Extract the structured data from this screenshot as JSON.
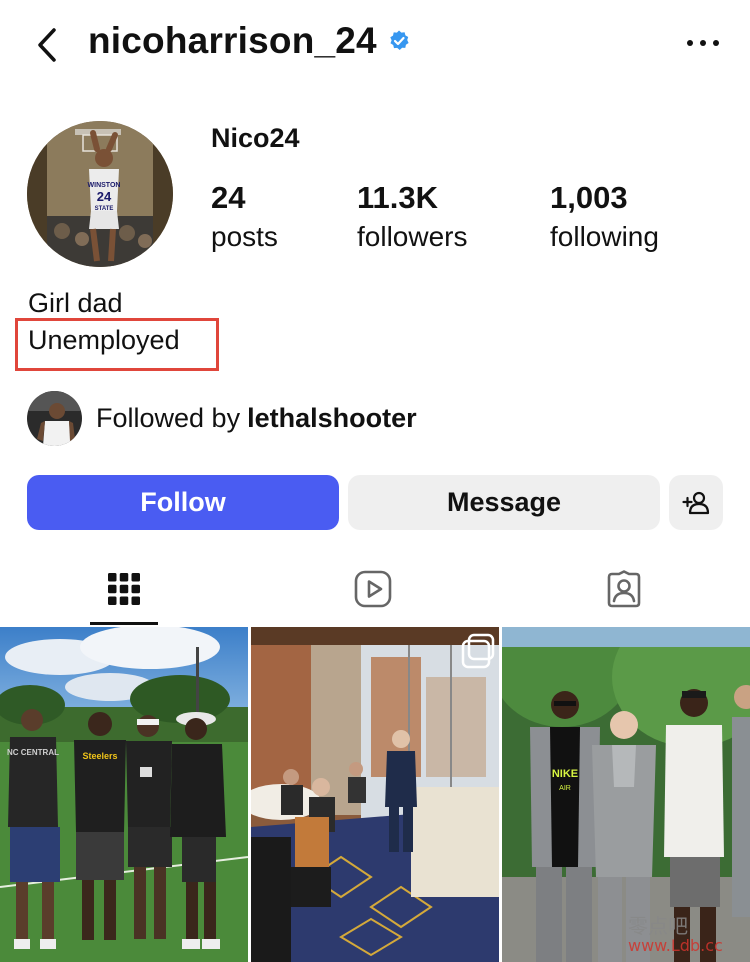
{
  "header": {
    "username": "nicoharrison_24",
    "verified": true,
    "back_icon": "chevron-left-icon",
    "more_icon": "more-horizontal-icon"
  },
  "profile": {
    "display_name": "Nico24",
    "stats": [
      {
        "value": "24",
        "label": "posts"
      },
      {
        "value": "11.3K",
        "label": "followers"
      },
      {
        "value": "1,003",
        "label": "following"
      }
    ],
    "bio": [
      "Girl dad",
      "Unemployed"
    ],
    "highlight_color": "#e0463b"
  },
  "followed_by": {
    "prefix": "Followed by",
    "name": "lethalshooter"
  },
  "actions": {
    "follow_label": "Follow",
    "message_label": "Message",
    "add_user_icon": "add-user-icon",
    "accent_color": "#4a5cf2"
  },
  "tabs": [
    {
      "name": "grid",
      "icon": "grid-icon",
      "active": true
    },
    {
      "name": "reels",
      "icon": "reels-icon",
      "active": false
    },
    {
      "name": "tagged",
      "icon": "tagged-icon",
      "active": false
    }
  ],
  "posts": [
    {
      "shirt_text": "Steelers",
      "shirt_text_2": "NC CENTRAL"
    },
    {
      "icon": "multiple-photos-icon"
    },
    {
      "shirt_text": "NIKE",
      "shirt_text_2": "AIR"
    }
  ],
  "watermark": {
    "line1": "零点吧",
    "line2": "www.Ldb.cc"
  }
}
